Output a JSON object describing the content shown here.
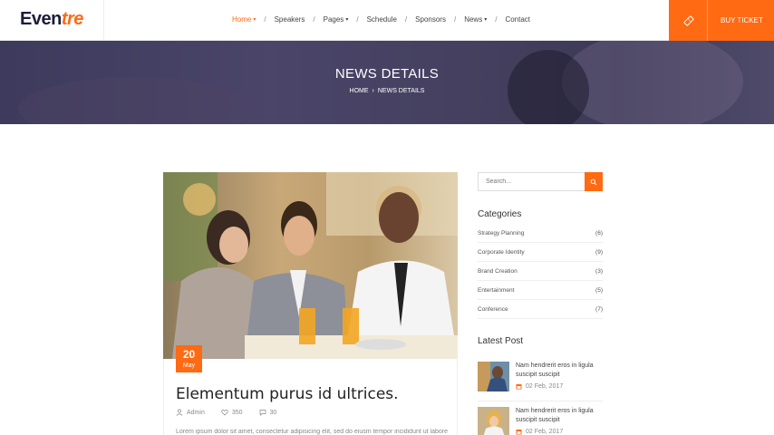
{
  "brand": {
    "logo_part1": "Even",
    "logo_part2": "tre",
    "accent": "#ff6a13"
  },
  "nav": {
    "items": [
      {
        "label": "Home",
        "dropdown": true,
        "active": true
      },
      {
        "label": "Speakers",
        "dropdown": false
      },
      {
        "label": "Pages",
        "dropdown": true
      },
      {
        "label": "Schedule",
        "dropdown": false
      },
      {
        "label": "Sponsors",
        "dropdown": false
      },
      {
        "label": "News",
        "dropdown": true
      },
      {
        "label": "Contact",
        "dropdown": false
      }
    ],
    "buy_label": "BUY TICKET",
    "buy_icon": "ticket-icon"
  },
  "hero": {
    "title": "NEWS DETAILS",
    "breadcrumb": [
      "HOME",
      "NEWS DETAILS"
    ]
  },
  "article": {
    "date_day": "20",
    "date_month": "May",
    "title": "Elementum purus id ultrices.",
    "author": "Admin",
    "likes": "350",
    "comments": "30",
    "excerpt": "Lorem ipsum dolor sit amet, consectetur adipisicing elit, sed do eiusm tempor incididunt ut labore"
  },
  "sidebar": {
    "search_placeholder": "Search...",
    "categories_title": "Categories",
    "categories": [
      {
        "name": "Strategy Planning",
        "count": "(6)"
      },
      {
        "name": "Corporate Identity",
        "count": "(9)"
      },
      {
        "name": "Brand Creation",
        "count": "(3)"
      },
      {
        "name": "Entertainment",
        "count": "(5)"
      },
      {
        "name": "Conference",
        "count": "(7)"
      }
    ],
    "latest_title": "Latest Post",
    "posts": [
      {
        "title_line1": "Nam hendrerit eros in ligula",
        "title_line2": "suscipit suscipit",
        "date": "02 Feb, 2017"
      },
      {
        "title_line1": "Nam hendrerit eros in ligula",
        "title_line2": "suscipit suscipit",
        "date": "02 Feb, 2017"
      }
    ]
  }
}
